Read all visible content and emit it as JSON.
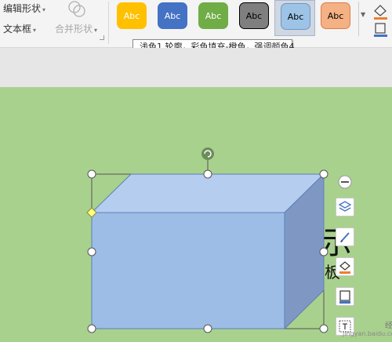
{
  "ribbon": {
    "edit_shape_label": "编辑形状",
    "text_box_label": "文本框",
    "merge_shapes_label": "合并形状",
    "dropdown_arrow": "▾"
  },
  "style_gallery": {
    "swatches": [
      {
        "label": "Abc",
        "fill": "#ffc000",
        "text_color": "#ffffff",
        "border": "#ffc000"
      },
      {
        "label": "Abc",
        "fill": "#4472c4",
        "text_color": "#ffffff",
        "border": "#4472c4"
      },
      {
        "label": "Abc",
        "fill": "#70ad47",
        "text_color": "#ffffff",
        "border": "#70ad47"
      },
      {
        "label": "Abc",
        "fill": "#7f7f7f",
        "text_color": "#000000",
        "border": "#000000"
      },
      {
        "label": "Abc",
        "fill": "#9dc3e6",
        "text_color": "#000000",
        "border": "#6f95c3"
      },
      {
        "label": "Abc",
        "fill": "#f4b183",
        "text_color": "#000000",
        "border": "#e07a4a"
      }
    ],
    "selected_index": 4
  },
  "tooltip": {
    "text": "浅色1 轮廓，彩色填充-橙色，强调颜色4"
  },
  "slide": {
    "background": "#a9d18e",
    "title_partial": "示",
    "subtitle_partial": "板"
  },
  "shape": {
    "front_color": "#9dbde6",
    "top_color": "#b5cdee",
    "side_color": "#7f98c3",
    "outline_color": "#5b7fb8"
  },
  "floating_toolbar": {
    "buttons": [
      "collapse-icon",
      "layers-icon",
      "pen-icon",
      "fill-bucket-icon",
      "frame-icon",
      "text-box-icon"
    ]
  },
  "watermark": {
    "text": "经验",
    "url": "jingyan.baidu.com"
  }
}
